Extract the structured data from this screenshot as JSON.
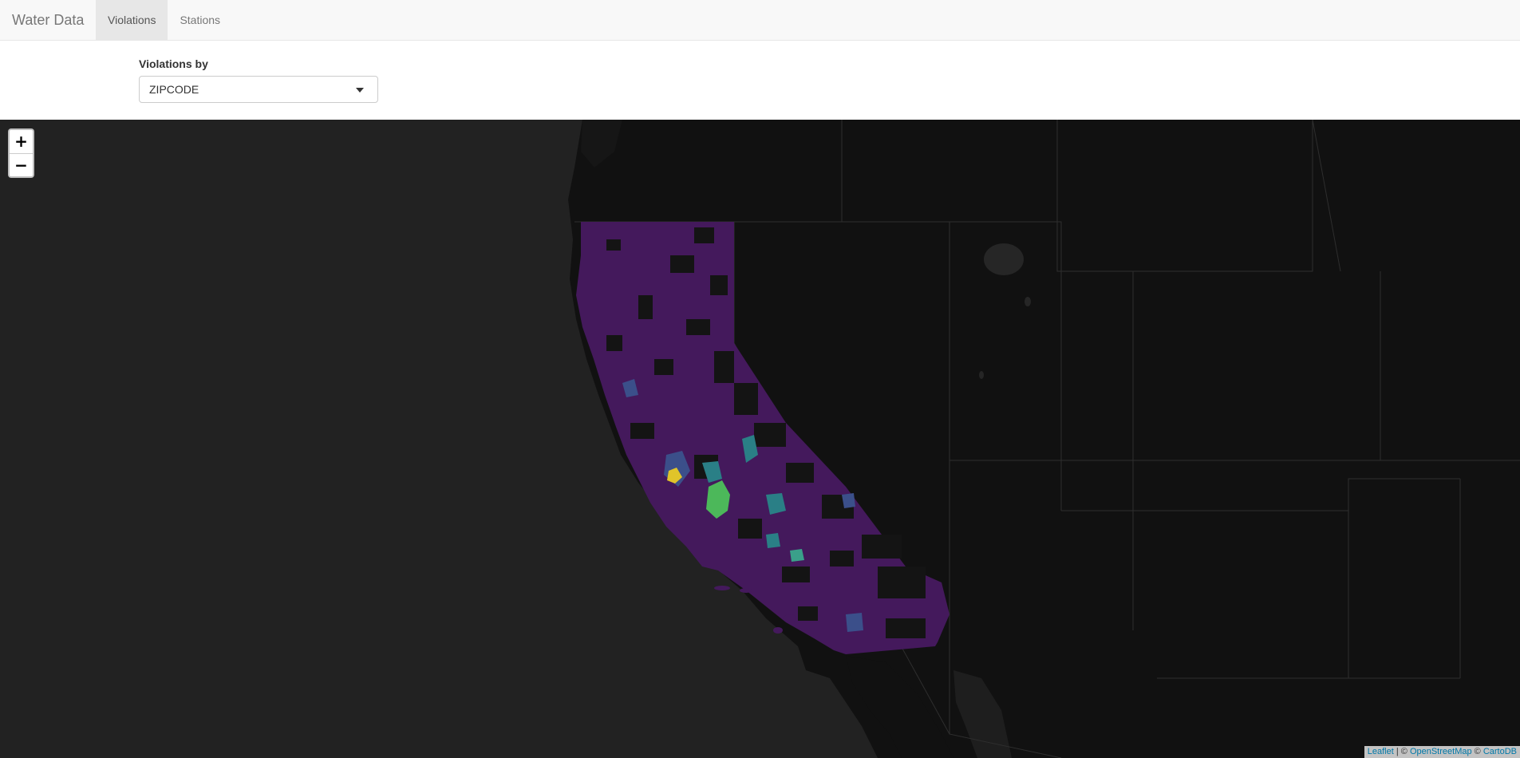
{
  "navbar": {
    "brand": "Water Data",
    "tabs": [
      {
        "label": "Violations",
        "active": true
      },
      {
        "label": "Stations",
        "active": false
      }
    ]
  },
  "controls": {
    "violations_by_label": "Violations by",
    "violations_by_value": "ZIPCODE"
  },
  "map": {
    "zoom_in": "+",
    "zoom_out": "−",
    "attribution": {
      "leaflet": "Leaflet",
      "sep1": " | © ",
      "osm": "OpenStreetMap",
      "sep2": " © ",
      "carto": "CartoDB"
    },
    "colors": {
      "ocean": "#222222",
      "land": "#111111",
      "borders": "#2b2b2b",
      "choropleth_low": "#44195c",
      "choropleth_mid": "#3b4f8a",
      "choropleth_teal": "#2a7f86",
      "choropleth_green": "#4cb85a",
      "choropleth_high": "#e0c42a"
    },
    "basemap_style": "dark",
    "layer": "choropleth"
  }
}
